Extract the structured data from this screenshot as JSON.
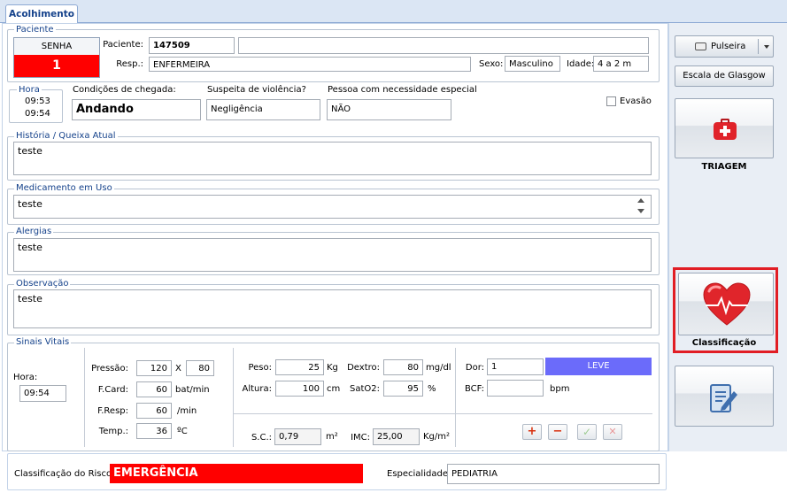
{
  "tab": {
    "label": "Acolhimento"
  },
  "paciente": {
    "legend": "Paciente",
    "senha_label": "SENHA",
    "senha_value": "1",
    "paciente_label": "Paciente:",
    "paciente_value": "147509",
    "paciente_name": "",
    "resp_label": "Resp.:",
    "resp_value": "ENFERMEIRA",
    "sexo_label": "Sexo:",
    "sexo_value": "Masculino",
    "idade_label": "Idade:",
    "idade_value": "4 a 2 m"
  },
  "chegada": {
    "hora_legend": "Hora",
    "hora1": "09:53",
    "hora2": "09:54",
    "condicoes_label": "Condições de chegada:",
    "condicoes_value": "Andando",
    "violencia_label": "Suspeita de violência?",
    "violencia_value": "Negligência",
    "especial_label": "Pessoa com necessidade especial",
    "especial_value": "NÃO",
    "evasao_label": "Evasão",
    "evasao_checked": false
  },
  "historia": {
    "legend": "História / Queixa Atual",
    "value": "teste"
  },
  "medicamento": {
    "legend": "Medicamento em Uso",
    "value": "teste"
  },
  "alergias": {
    "legend": "Alergias",
    "value": "teste"
  },
  "observacao": {
    "legend": "Observação",
    "value": "teste"
  },
  "sinais": {
    "legend": "Sinais Vitais",
    "hora_label": "Hora:",
    "hora_value": "09:54",
    "pressao_label": "Pressão:",
    "pressao_sys": "120",
    "pressao_x": "X",
    "pressao_dia": "80",
    "fcard_label": "F.Card:",
    "fcard_value": "60",
    "fcard_unit": "bat/min",
    "fresp_label": "F.Resp:",
    "fresp_value": "60",
    "fresp_unit": "/min",
    "temp_label": "Temp.:",
    "temp_value": "36",
    "temp_unit": "ºC",
    "peso_label": "Peso:",
    "peso_value": "25",
    "peso_unit": "Kg",
    "altura_label": "Altura:",
    "altura_value": "100",
    "altura_unit": "cm",
    "dextro_label": "Dextro:",
    "dextro_value": "80",
    "dextro_unit": "mg/dl",
    "sato2_label": "SatO2:",
    "sato2_value": "95",
    "sato2_unit": "%",
    "sc_label": "S.C.:",
    "sc_value": "0,79",
    "sc_unit": "m²",
    "imc_label": "IMC:",
    "imc_value": "25,00",
    "imc_unit": "Kg/m²",
    "dor_label": "Dor:",
    "dor_value": "1",
    "dor_level": "LEVE",
    "bcf_label": "BCF:",
    "bcf_value": "",
    "bcf_unit": "bpm",
    "btn_add": "+",
    "btn_remove": "−",
    "btn_confirm": "✓",
    "btn_cancel": "✕"
  },
  "risco": {
    "label": "Classificação do Risco:",
    "value": "EMERGÊNCIA",
    "especialidade_label": "Especialidade:",
    "especialidade_value": "PEDIATRIA"
  },
  "sidebar": {
    "pulseira_label": "Pulseira",
    "glasgow_label": "Escala de Glasgow",
    "triagem_label": "TRIAGEM",
    "classificacao_label": "Classificação"
  },
  "colors": {
    "senha_bg": "#ff0000",
    "risco_bg": "#ff0000",
    "dor_bg": "#6b6bfa",
    "legend": "#15428b",
    "highlight_border": "#e11d24"
  }
}
